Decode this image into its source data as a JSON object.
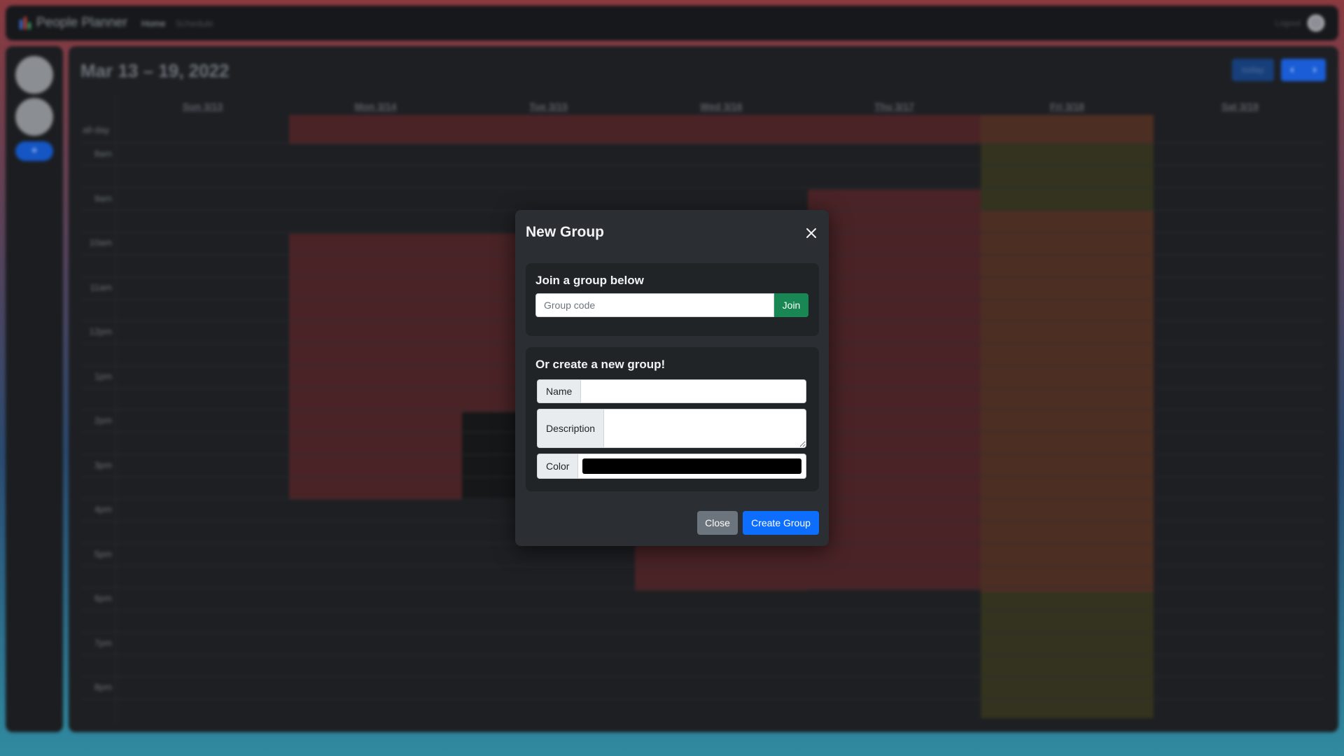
{
  "navbar": {
    "brand": "People Planner",
    "links": [
      "Home",
      "Schedule"
    ],
    "logout": "Logout"
  },
  "sidebar": {
    "add_label": "+"
  },
  "calendar": {
    "title": "Mar 13 – 19, 2022",
    "today_label": "today",
    "prev_icon": "chevron-left-icon",
    "next_icon": "chevron-right-icon",
    "days": [
      "Sun 3/13",
      "Mon 3/14",
      "Tue 3/15",
      "Wed 3/16",
      "Thu 3/17",
      "Fri 3/18",
      "Sat 3/19"
    ],
    "allday_label": "all-day",
    "times": [
      "8am",
      "9am",
      "10am",
      "11am",
      "12pm",
      "1pm",
      "2pm",
      "3pm",
      "4pm",
      "5pm",
      "6pm",
      "7pm",
      "8pm"
    ],
    "colors": {
      "red": "#4a2326",
      "orange": "#4d2e23",
      "olive": "#33331f",
      "dark": "#161718"
    }
  },
  "modal": {
    "title": "New Group",
    "close_icon": "close-icon",
    "join": {
      "heading": "Join a group below",
      "placeholder": "Group code",
      "button": "Join"
    },
    "create": {
      "heading": "Or create a new group!",
      "name_label": "Name",
      "name_value": "",
      "description_label": "Description",
      "description_value": "",
      "color_label": "Color",
      "color_value": "#000000"
    },
    "close_button": "Close",
    "create_button": "Create Group",
    "colors": {
      "close_button_bg": "#6c757d",
      "create_button_bg": "#0d6efd",
      "join_button_bg": "#198754"
    }
  }
}
